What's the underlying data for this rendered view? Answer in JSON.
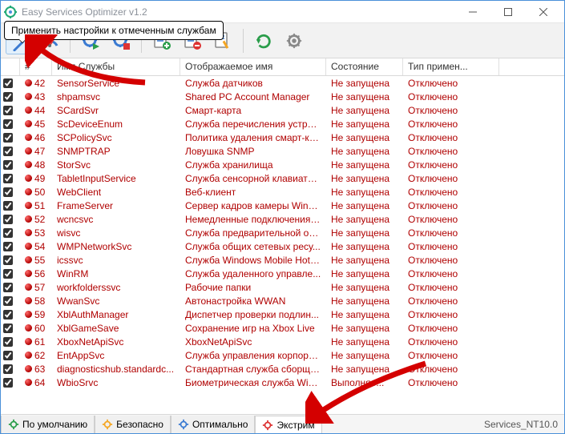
{
  "title": "Easy Services Optimizer v1.2",
  "tooltip": "Применить настройки к отмеченным службам",
  "columns": {
    "idx": "#",
    "name": "Имя Службы",
    "display": "Отображаемое имя",
    "state": "Состояние",
    "start": "Тип примен..."
  },
  "status_tabs": {
    "default": "По умолчанию",
    "safe": "Безопасно",
    "optimal": "Оптимально",
    "extreme": "Экстрим"
  },
  "status_right": "Services_NT10.0",
  "common": {
    "state": "Не запущена",
    "start": "Отключено"
  },
  "rows": [
    {
      "idx": 42,
      "name": "SensorService",
      "disp": "Служба датчиков"
    },
    {
      "idx": 43,
      "name": "shpamsvc",
      "disp": "Shared PC Account Manager"
    },
    {
      "idx": 44,
      "name": "SCardSvr",
      "disp": "Смарт-карта"
    },
    {
      "idx": 45,
      "name": "ScDeviceEnum",
      "disp": "Служба перечисления устрой..."
    },
    {
      "idx": 46,
      "name": "SCPolicySvc",
      "disp": "Политика удаления смарт-карт"
    },
    {
      "idx": 47,
      "name": "SNMPTRAP",
      "disp": "Ловушка SNMP"
    },
    {
      "idx": 48,
      "name": "StorSvc",
      "disp": "Служба хранилища"
    },
    {
      "idx": 49,
      "name": "TabletInputService",
      "disp": "Служба сенсорной клавиатур..."
    },
    {
      "idx": 50,
      "name": "WebClient",
      "disp": "Веб-клиент"
    },
    {
      "idx": 51,
      "name": "FrameServer",
      "disp": "Сервер кадров камеры Windo..."
    },
    {
      "idx": 52,
      "name": "wcncsvc",
      "disp": "Немедленные подключения W..."
    },
    {
      "idx": 53,
      "name": "wisvc",
      "disp": "Служба предварительной оц..."
    },
    {
      "idx": 54,
      "name": "WMPNetworkSvc",
      "disp": "Служба общих сетевых ресу..."
    },
    {
      "idx": 55,
      "name": "icssvc",
      "disp": "Служба Windows Mobile Hotspot"
    },
    {
      "idx": 56,
      "name": "WinRM",
      "disp": "Служба удаленного управле..."
    },
    {
      "idx": 57,
      "name": "workfolderssvc",
      "disp": "Рабочие папки"
    },
    {
      "idx": 58,
      "name": "WwanSvc",
      "disp": "Автонастройка WWAN"
    },
    {
      "idx": 59,
      "name": "XblAuthManager",
      "disp": "Диспетчер проверки подлин..."
    },
    {
      "idx": 60,
      "name": "XblGameSave",
      "disp": "Сохранение игр на Xbox Live"
    },
    {
      "idx": 61,
      "name": "XboxNetApiSvc",
      "disp": "XboxNetApiSvc"
    },
    {
      "idx": 62,
      "name": "EntAppSvc",
      "disp": "Служба управления корпора..."
    },
    {
      "idx": 63,
      "name": "diagnosticshub.standardc...",
      "disp": "Стандартная служба сборщи..."
    },
    {
      "idx": 64,
      "name": "WbioSrvc",
      "disp": "Биометрическая служба Win...",
      "state": "Выполняе..."
    }
  ]
}
